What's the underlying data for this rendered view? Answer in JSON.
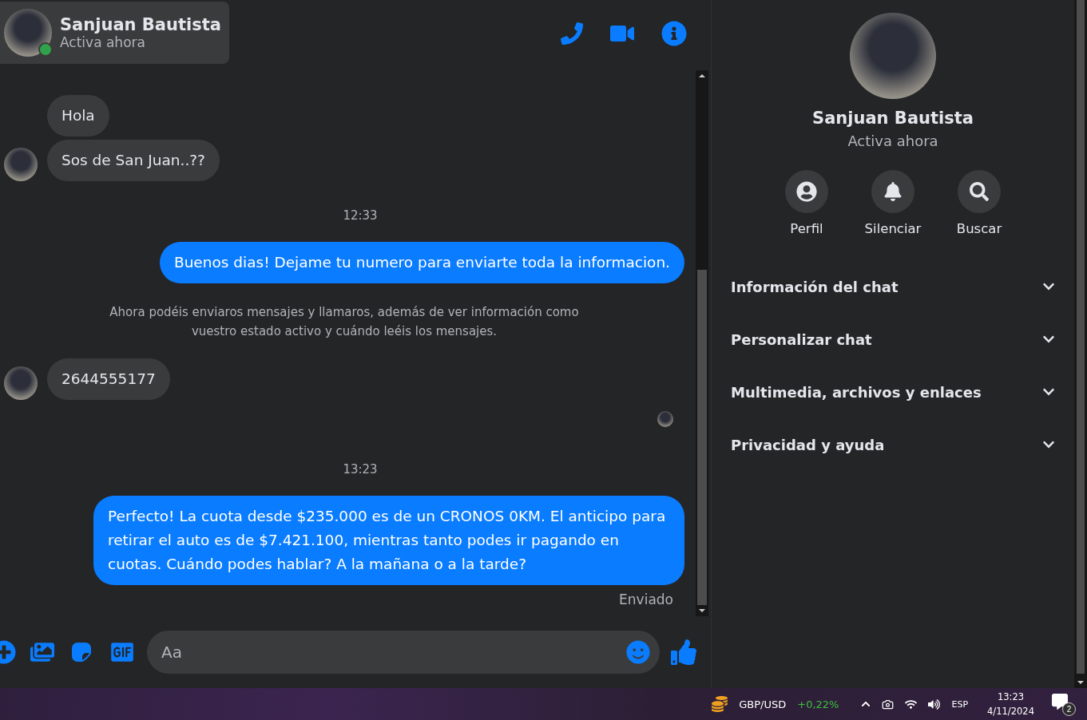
{
  "chat_header": {
    "name": "Sanjuan Bautista",
    "status": "Activa ahora",
    "online": true
  },
  "messages": [
    {
      "kind": "incoming",
      "text": "Hola",
      "show_avatar": false
    },
    {
      "kind": "incoming",
      "text": "Sos de San Juan..??",
      "show_avatar": true
    },
    {
      "kind": "time",
      "text": "12:33"
    },
    {
      "kind": "outgoing",
      "text": "Buenos dias! Dejame tu numero para enviarte toda la informacion."
    },
    {
      "kind": "notice",
      "text": "Ahora podéis enviaros mensajes y llamaros, además de ver información como vuestro estado activo y cuándo leéis los mensajes."
    },
    {
      "kind": "incoming",
      "text": "2644555177",
      "show_avatar": true
    },
    {
      "kind": "seen"
    },
    {
      "kind": "time",
      "text": "13:23"
    },
    {
      "kind": "outgoing",
      "text": "Perfecto! La cuota desde $235.000 es de un CRONOS 0KM. El anticipo para retirar el auto es de $7.421.100, mientras tanto podes ir pagando en cuotas. Cuándo podes hablar? A la mañana o a la tarde?"
    },
    {
      "kind": "status",
      "text": "Enviado"
    }
  ],
  "composer": {
    "placeholder": "Aa"
  },
  "profile": {
    "name": "Sanjuan Bautista",
    "status": "Activa ahora",
    "actions": [
      {
        "kind": "profile",
        "label": "Perfil"
      },
      {
        "kind": "mute",
        "label": "Silenciar"
      },
      {
        "kind": "search",
        "label": "Buscar"
      }
    ],
    "sections": [
      {
        "label": "Información del chat",
        "expanded": false
      },
      {
        "label": "Personalizar chat",
        "expanded": false
      },
      {
        "label": "Multimedia, archivos y enlaces",
        "expanded": false
      },
      {
        "label": "Privacidad y ayuda",
        "expanded": false
      }
    ]
  },
  "taskbar": {
    "ticker": "GBP/USD",
    "change": "+0,22%",
    "language": "ESP",
    "time": "13:23",
    "date": "4/11/2024",
    "notifications": "2"
  }
}
